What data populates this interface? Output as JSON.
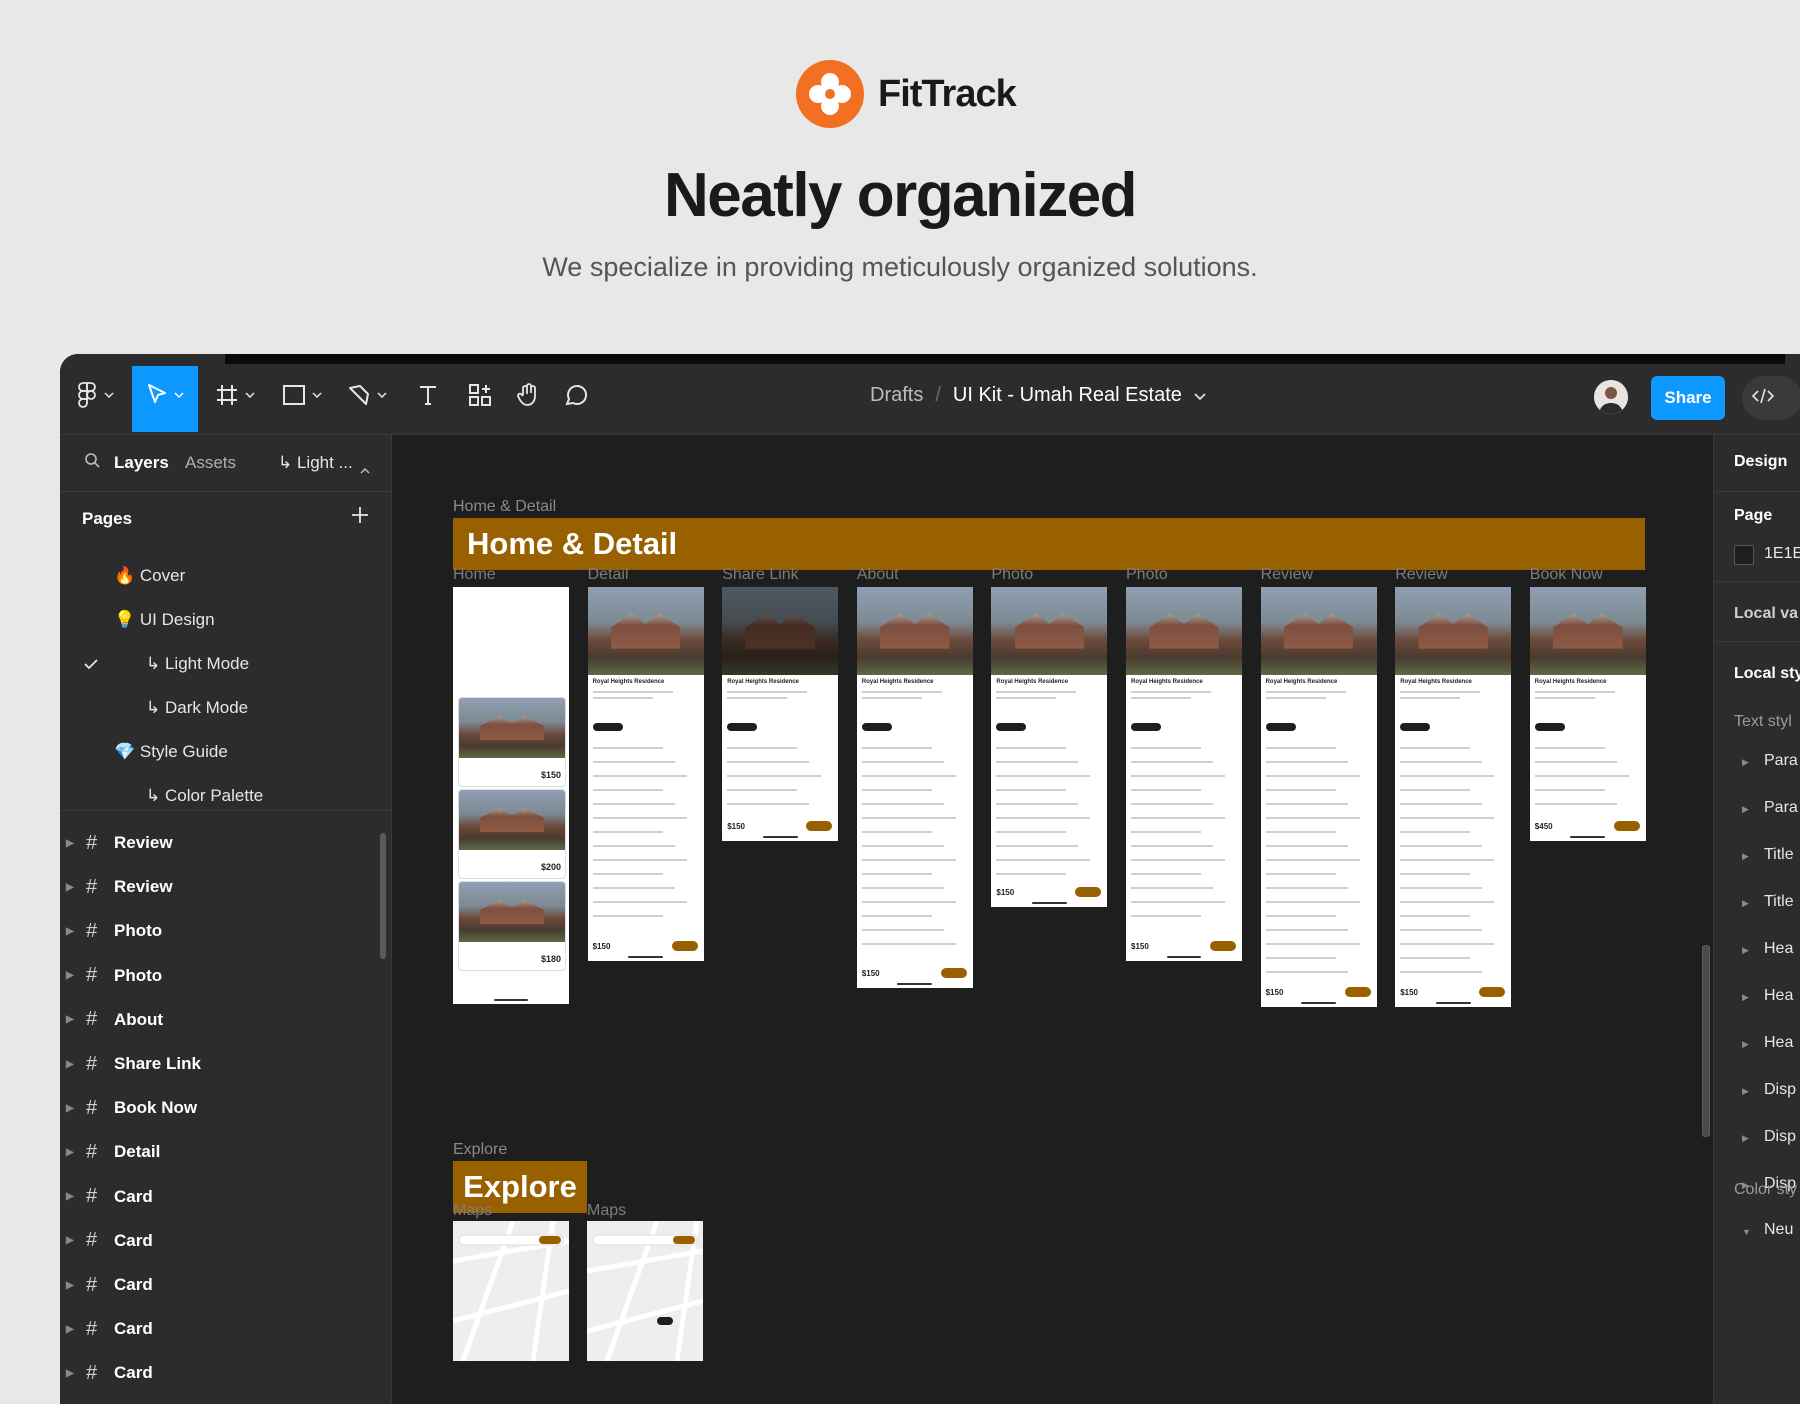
{
  "hero": {
    "brand": "FitTrack",
    "title": "Neatly organized",
    "subtitle": "We specialize in providing meticulously organized solutions."
  },
  "toolbar": {
    "tools": [
      "main-menu-icon",
      "move-icon",
      "frame-icon",
      "rectangle-icon",
      "pen-icon",
      "text-icon",
      "components-icon",
      "hand-icon",
      "comment-icon"
    ],
    "breadcrumb_root": "Drafts",
    "breadcrumb_sep": "/",
    "file_name": "UI Kit - Umah Real Estate",
    "share_label": "Share",
    "accent": "#0d99ff"
  },
  "left_panel": {
    "tab_layers": "Layers",
    "tab_assets": "Assets",
    "current_page": "↳ Light ...",
    "pages_title": "Pages",
    "pages": [
      {
        "label": "🔥 Cover"
      },
      {
        "label": "💡 UI Design"
      },
      {
        "label": "↳ Light Mode",
        "selected": true
      },
      {
        "label": "↳ Dark Mode"
      },
      {
        "label": "💎 Style Guide"
      },
      {
        "label": "↳ Color Palette"
      }
    ],
    "layers": [
      "Review",
      "Review",
      "Photo",
      "Photo",
      "About",
      "Share Link",
      "Book Now",
      "Detail",
      "Card",
      "Card",
      "Card",
      "Card",
      "Card"
    ]
  },
  "canvas": {
    "section1_label": "Home & Detail",
    "section1_banner": "Home & Detail",
    "section1_frames": [
      "Home",
      "Detail",
      "Share Link",
      "About",
      "Photo",
      "Photo",
      "Review",
      "Review",
      "Book Now"
    ],
    "section2_label": "Explore",
    "section2_banner": "Explore",
    "section2_frames": [
      "Maps",
      "Maps"
    ],
    "banner_color": "#996000",
    "card_title": "Royal Heights Residence",
    "price": "$150",
    "price_2": "$200",
    "price_3": "$180",
    "price_book": "$450"
  },
  "right_panel": {
    "design_tab": "Design",
    "page_heading": "Page",
    "page_color": "1E1E",
    "local_variables": "Local va",
    "local_styles": "Local sty",
    "text_styles": "Text styl",
    "text_style_items": [
      "Para",
      "Para",
      "Title",
      "Title",
      "Hea",
      "Hea",
      "Hea",
      "Disp",
      "Disp",
      "Disp"
    ],
    "color_styles": "Color sty",
    "color_style_first": "Neu"
  }
}
